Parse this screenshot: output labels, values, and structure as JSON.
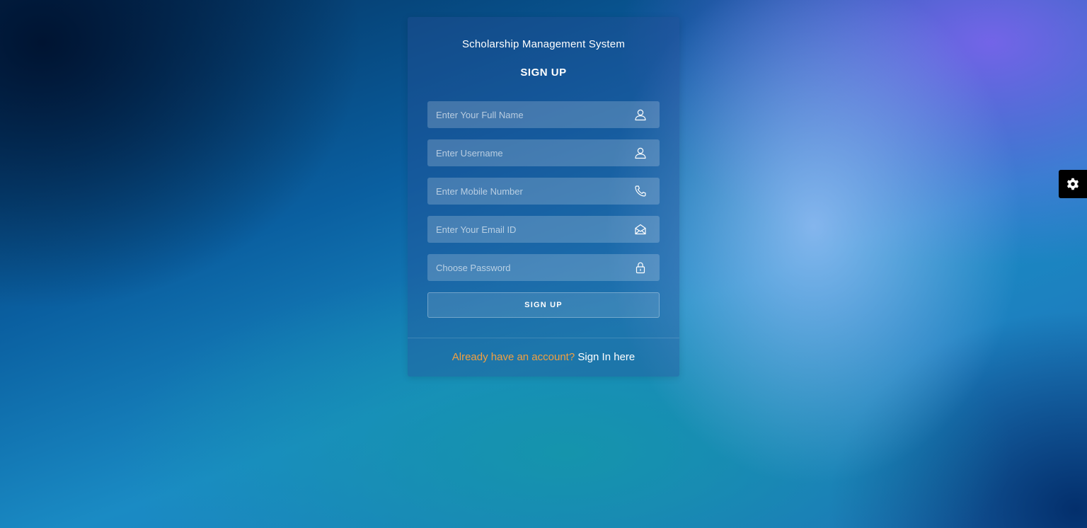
{
  "app": {
    "title": "Scholarship Management System"
  },
  "form": {
    "heading": "SIGN UP",
    "fields": [
      {
        "placeholder": "Enter Your Full Name",
        "value": "",
        "icon": "user-icon"
      },
      {
        "placeholder": "Enter Username",
        "value": "",
        "icon": "user-icon"
      },
      {
        "placeholder": "Enter Mobile Number",
        "value": "",
        "icon": "phone-icon"
      },
      {
        "placeholder": "Enter Your Email ID",
        "value": "",
        "icon": "envelope-icon"
      },
      {
        "placeholder": "Choose Password",
        "value": "",
        "icon": "lock-icon"
      }
    ],
    "submit_label": "SIGN UP"
  },
  "footer": {
    "prompt": "Already have an account?",
    "link_label": "Sign In here"
  },
  "settings": {
    "icon": "gear-icon"
  },
  "colors": {
    "accent_prompt": "#f2a040",
    "text": "#ffffff",
    "settings_bg": "#000000"
  }
}
